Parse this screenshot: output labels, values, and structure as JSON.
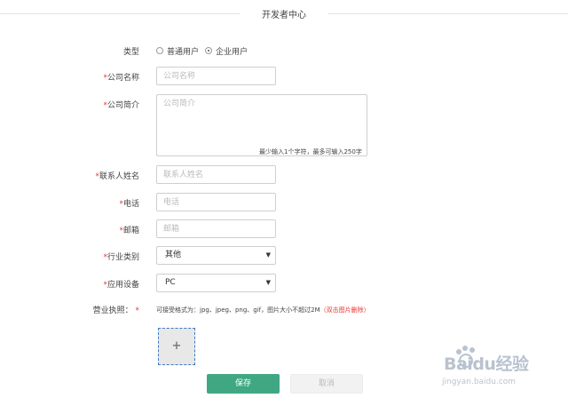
{
  "header": {
    "title": "开发者中心"
  },
  "form": {
    "type": {
      "label": "类型",
      "options": [
        {
          "label": "普通用户",
          "checked": false
        },
        {
          "label": "企业用户",
          "checked": true
        }
      ]
    },
    "company_name": {
      "label": "公司名称",
      "placeholder": "公司名称",
      "required": true
    },
    "company_intro": {
      "label": "公司简介",
      "placeholder": "公司简介",
      "counter": "最少输入1个字符，最多可输入250字",
      "required": true
    },
    "contact_name": {
      "label": "联系人姓名",
      "placeholder": "联系人姓名",
      "required": true
    },
    "phone": {
      "label": "电话",
      "placeholder": "电话",
      "required": true
    },
    "email": {
      "label": "邮箱",
      "placeholder": "邮箱",
      "required": true
    },
    "industry": {
      "label": "行业类别",
      "value": "其他",
      "required": true
    },
    "device": {
      "label": "应用设备",
      "value": "PC",
      "required": true
    },
    "license": {
      "label": "营业执照：",
      "required_mark": "*",
      "hint": "可接受格式为：jpg、jpeg、png、gif，图片大小不超过2M",
      "hint_note": "（双击图片删除）"
    }
  },
  "buttons": {
    "save": "保存",
    "cancel": "取消"
  },
  "watermark": {
    "brand": "Baidu经验",
    "url": "jingyan.baidu.com"
  },
  "colors": {
    "accent": "#3fa883",
    "required": "#e33333",
    "upload_border": "#3e78c6"
  }
}
